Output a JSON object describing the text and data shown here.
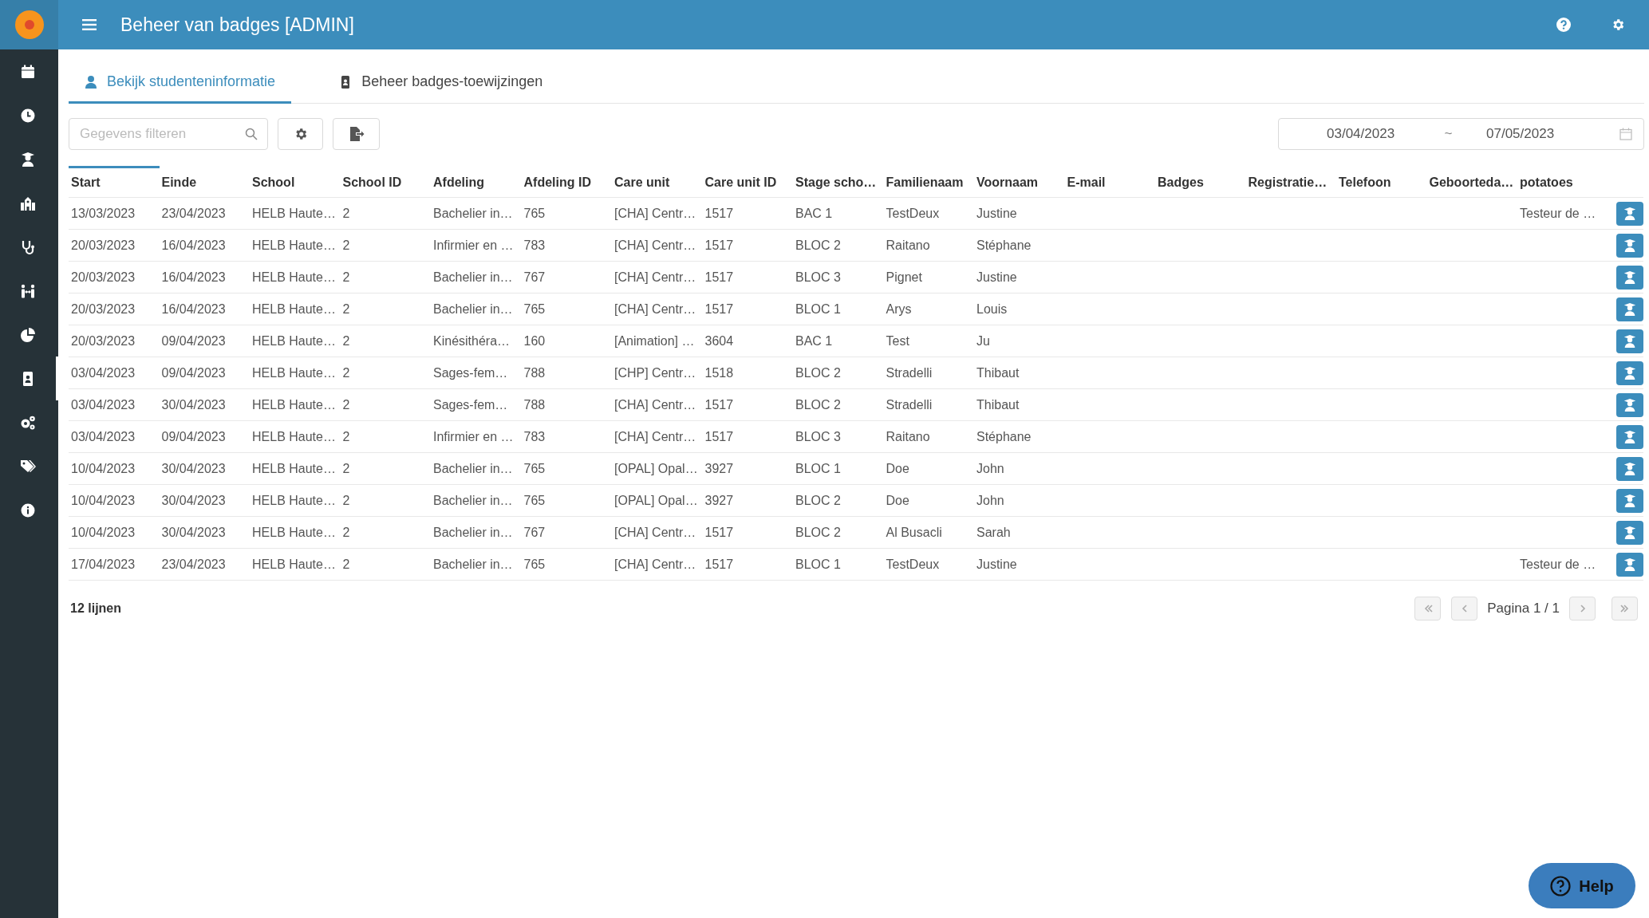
{
  "header": {
    "title": "Beheer van badges [ADMIN]"
  },
  "sidebar": {
    "items": [
      {
        "kind": "calendar",
        "selected": false
      },
      {
        "kind": "clock",
        "selected": false
      },
      {
        "kind": "graduate",
        "selected": false
      },
      {
        "kind": "building",
        "selected": false
      },
      {
        "kind": "stethoscope",
        "selected": false
      },
      {
        "kind": "people",
        "selected": false
      },
      {
        "kind": "pie",
        "selected": false
      },
      {
        "kind": "badge",
        "selected": true
      },
      {
        "kind": "gears",
        "selected": false
      },
      {
        "kind": "tags",
        "selected": false
      },
      {
        "kind": "info",
        "selected": false
      }
    ]
  },
  "tabs": [
    {
      "label": "Bekijk studenteninformatie",
      "kind": "user",
      "selected": true
    },
    {
      "label": "Beheer badges-toewijzingen",
      "kind": "badge",
      "selected": false
    }
  ],
  "toolbar": {
    "search": {
      "placeholder": "Gegevens filteren"
    },
    "date_range": {
      "from": "03/04/2023",
      "separator": "~",
      "to": "07/05/2023"
    }
  },
  "table": {
    "columns": [
      {
        "label": "Start",
        "sorted": true
      },
      {
        "label": "Einde",
        "sorted": false
      },
      {
        "label": "School",
        "sorted": false
      },
      {
        "label": "School ID",
        "sorted": false
      },
      {
        "label": "Afdeling",
        "sorted": false
      },
      {
        "label": "Afdeling ID",
        "sorted": false
      },
      {
        "label": "Care unit",
        "sorted": false
      },
      {
        "label": "Care unit ID",
        "sorted": false
      },
      {
        "label": "Stage scho…",
        "sorted": false
      },
      {
        "label": "Familienaam",
        "sorted": false
      },
      {
        "label": "Voornaam",
        "sorted": false
      },
      {
        "label": "E-mail",
        "sorted": false
      },
      {
        "label": "Badges",
        "sorted": false
      },
      {
        "label": "Registratie…",
        "sorted": false
      },
      {
        "label": "Telefoon",
        "sorted": false
      },
      {
        "label": "Geboorteda…",
        "sorted": false
      },
      {
        "label": "potatoes",
        "sorted": false
      }
    ],
    "rows": [
      {
        "start": "13/03/2023",
        "einde": "23/04/2023",
        "school": "HELB Haute…",
        "school_id": "2",
        "afdeling": "Bachelier in…",
        "afdeling_id": "765",
        "care_unit": "[CHA] Centr…",
        "care_unit_id": "1517",
        "stage": "BAC 1",
        "familienaam": "TestDeux",
        "voornaam": "Justine",
        "potatoes": "Testeur de …"
      },
      {
        "start": "20/03/2023",
        "einde": "16/04/2023",
        "school": "HELB Haute…",
        "school_id": "2",
        "afdeling": "Infirmier en …",
        "afdeling_id": "783",
        "care_unit": "[CHA] Centr…",
        "care_unit_id": "1517",
        "stage": "BLOC 2",
        "familienaam": "Raitano",
        "voornaam": "Stéphane"
      },
      {
        "start": "20/03/2023",
        "einde": "16/04/2023",
        "school": "HELB Haute…",
        "school_id": "2",
        "afdeling": "Bachelier in…",
        "afdeling_id": "767",
        "care_unit": "[CHA] Centr…",
        "care_unit_id": "1517",
        "stage": "BLOC 3",
        "familienaam": "Pignet",
        "voornaam": "Justine"
      },
      {
        "start": "20/03/2023",
        "einde": "16/04/2023",
        "school": "HELB Haute…",
        "school_id": "2",
        "afdeling": "Bachelier in…",
        "afdeling_id": "765",
        "care_unit": "[CHA] Centr…",
        "care_unit_id": "1517",
        "stage": "BLOC 1",
        "familienaam": "Arys",
        "voornaam": "Louis"
      },
      {
        "start": "20/03/2023",
        "einde": "09/04/2023",
        "school": "HELB Haute…",
        "school_id": "2",
        "afdeling": "Kinésithéra…",
        "afdeling_id": "160",
        "care_unit": "[Animation] …",
        "care_unit_id": "3604",
        "stage": "BAC 1",
        "familienaam": "Test",
        "voornaam": "Ju"
      },
      {
        "start": "03/04/2023",
        "einde": "09/04/2023",
        "school": "HELB Haute…",
        "school_id": "2",
        "afdeling": "Sages-fem…",
        "afdeling_id": "788",
        "care_unit": "[CHP] Centr…",
        "care_unit_id": "1518",
        "stage": "BLOC 2",
        "familienaam": "Stradelli",
        "voornaam": "Thibaut"
      },
      {
        "start": "03/04/2023",
        "einde": "30/04/2023",
        "school": "HELB Haute…",
        "school_id": "2",
        "afdeling": "Sages-fem…",
        "afdeling_id": "788",
        "care_unit": "[CHA] Centr…",
        "care_unit_id": "1517",
        "stage": "BLOC 2",
        "familienaam": "Stradelli",
        "voornaam": "Thibaut"
      },
      {
        "start": "03/04/2023",
        "einde": "09/04/2023",
        "school": "HELB Haute…",
        "school_id": "2",
        "afdeling": "Infirmier en …",
        "afdeling_id": "783",
        "care_unit": "[CHA] Centr…",
        "care_unit_id": "1517",
        "stage": "BLOC 3",
        "familienaam": "Raitano",
        "voornaam": "Stéphane"
      },
      {
        "start": "10/04/2023",
        "einde": "30/04/2023",
        "school": "HELB Haute…",
        "school_id": "2",
        "afdeling": "Bachelier in…",
        "afdeling_id": "765",
        "care_unit": "[OPAL] Opal…",
        "care_unit_id": "3927",
        "stage": "BLOC 1",
        "familienaam": "Doe",
        "voornaam": "John"
      },
      {
        "start": "10/04/2023",
        "einde": "30/04/2023",
        "school": "HELB Haute…",
        "school_id": "2",
        "afdeling": "Bachelier in…",
        "afdeling_id": "765",
        "care_unit": "[OPAL] Opal…",
        "care_unit_id": "3927",
        "stage": "BLOC 2",
        "familienaam": "Doe",
        "voornaam": "John"
      },
      {
        "start": "10/04/2023",
        "einde": "30/04/2023",
        "school": "HELB Haute…",
        "school_id": "2",
        "afdeling": "Bachelier in…",
        "afdeling_id": "767",
        "care_unit": "[CHA] Centr…",
        "care_unit_id": "1517",
        "stage": "BLOC 2",
        "familienaam": "Al Busacli",
        "voornaam": "Sarah"
      },
      {
        "start": "17/04/2023",
        "einde": "23/04/2023",
        "school": "HELB Haute…",
        "school_id": "2",
        "afdeling": "Bachelier in…",
        "afdeling_id": "765",
        "care_unit": "[CHA] Centr…",
        "care_unit_id": "1517",
        "stage": "BLOC 1",
        "familienaam": "TestDeux",
        "voornaam": "Justine",
        "potatoes": "Testeur de …"
      }
    ]
  },
  "footer": {
    "count": "12 lijnen",
    "page": "Pagina 1 / 1",
    "pager_buttons": [
      {
        "kind": "first",
        "disabled": true
      },
      {
        "kind": "prev",
        "disabled": true
      },
      {
        "kind": "next",
        "disabled": true
      },
      {
        "kind": "last",
        "disabled": true
      }
    ]
  },
  "help_button": {
    "label": "Help"
  }
}
